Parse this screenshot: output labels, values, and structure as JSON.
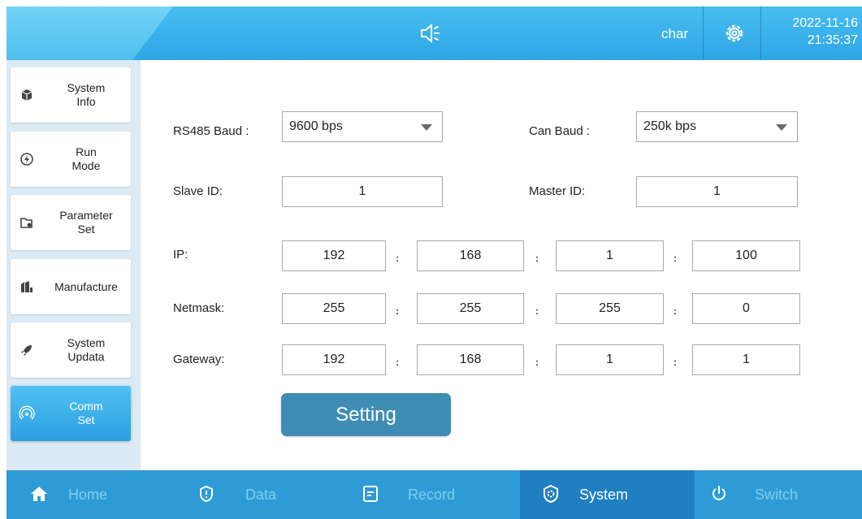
{
  "header": {
    "user": "char",
    "date": "2022-11-16",
    "time": "21:35:37",
    "icons": [
      "speaker-icon",
      "settings-gear-icon"
    ]
  },
  "sidebar": {
    "items": [
      {
        "label": "System\nInfo",
        "icon": "cube-icon"
      },
      {
        "label": "Run\nMode",
        "icon": "power-bolt-icon"
      },
      {
        "label": "Parameter\nSet",
        "icon": "folder-gear-icon"
      },
      {
        "label": "Manufacture",
        "icon": "factory-icon"
      },
      {
        "label": "System\nUpdata",
        "icon": "rocket-icon"
      },
      {
        "label": "Comm\nSet",
        "icon": "wireless-signal-icon",
        "active": true
      }
    ]
  },
  "form": {
    "rs485_label": "RS485 Baud :",
    "rs485_value": "9600 bps",
    "can_label": "Can Baud :",
    "can_value": "250k bps",
    "slave_label": "Slave ID:",
    "slave_value": "1",
    "master_label": "Master ID:",
    "master_value": "1",
    "ip_label": "IP:",
    "ip": [
      "192",
      "168",
      "1",
      "100"
    ],
    "netmask_label": "Netmask:",
    "netmask": [
      "255",
      "255",
      "255",
      "0"
    ],
    "gateway_label": "Gateway:",
    "gateway": [
      "192",
      "168",
      "1",
      "1"
    ],
    "separator": ":",
    "setting_button": "Setting"
  },
  "bottom_nav": {
    "tabs": [
      {
        "label": "Home",
        "icon": "home-icon"
      },
      {
        "label": "Data",
        "icon": "shield-alert-icon"
      },
      {
        "label": "Record",
        "icon": "document-icon"
      },
      {
        "label": "System",
        "icon": "system-gear-icon",
        "active": true
      },
      {
        "label": "Switch",
        "icon": "power-icon"
      }
    ]
  },
  "colors": {
    "accent": "#2f9bd6",
    "active_menu": "#2c9fe0",
    "button": "#3f8db4",
    "sidebar_bg": "#dbeaf5"
  }
}
